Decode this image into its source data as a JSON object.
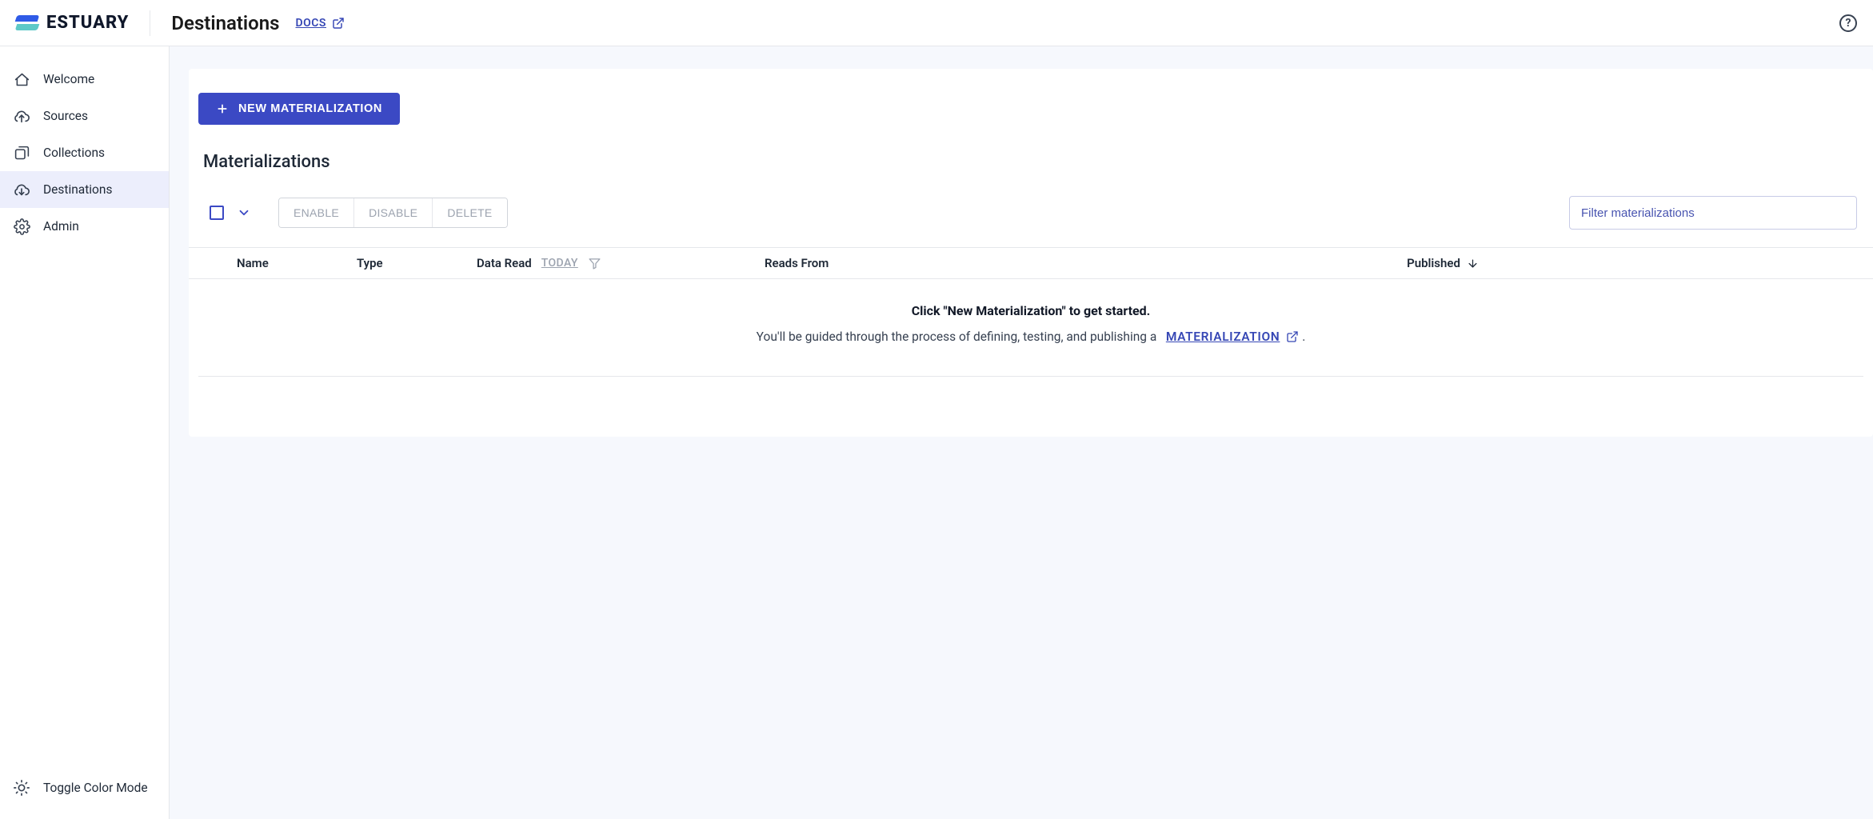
{
  "brand": {
    "name": "ESTUARY"
  },
  "header": {
    "title": "Destinations",
    "docs_label": "DOCS"
  },
  "sidebar": {
    "items": [
      {
        "label": "Welcome"
      },
      {
        "label": "Sources"
      },
      {
        "label": "Collections"
      },
      {
        "label": "Destinations"
      },
      {
        "label": "Admin"
      }
    ],
    "toggle_label": "Toggle Color Mode"
  },
  "main": {
    "new_button": "NEW MATERIALIZATION",
    "section_title": "Materializations",
    "actions": {
      "enable": "ENABLE",
      "disable": "DISABLE",
      "delete": "DELETE"
    },
    "filter_placeholder": "Filter materializations",
    "columns": {
      "name": "Name",
      "type": "Type",
      "data_read": "Data Read",
      "today": "TODAY",
      "reads_from": "Reads From",
      "published": "Published"
    },
    "empty": {
      "title": "Click \"New Materialization\" to get started.",
      "sub_prefix": "You'll be guided through the process of defining, testing, and publishing a",
      "link_label": "MATERIALIZATION",
      "sub_suffix": "."
    }
  }
}
